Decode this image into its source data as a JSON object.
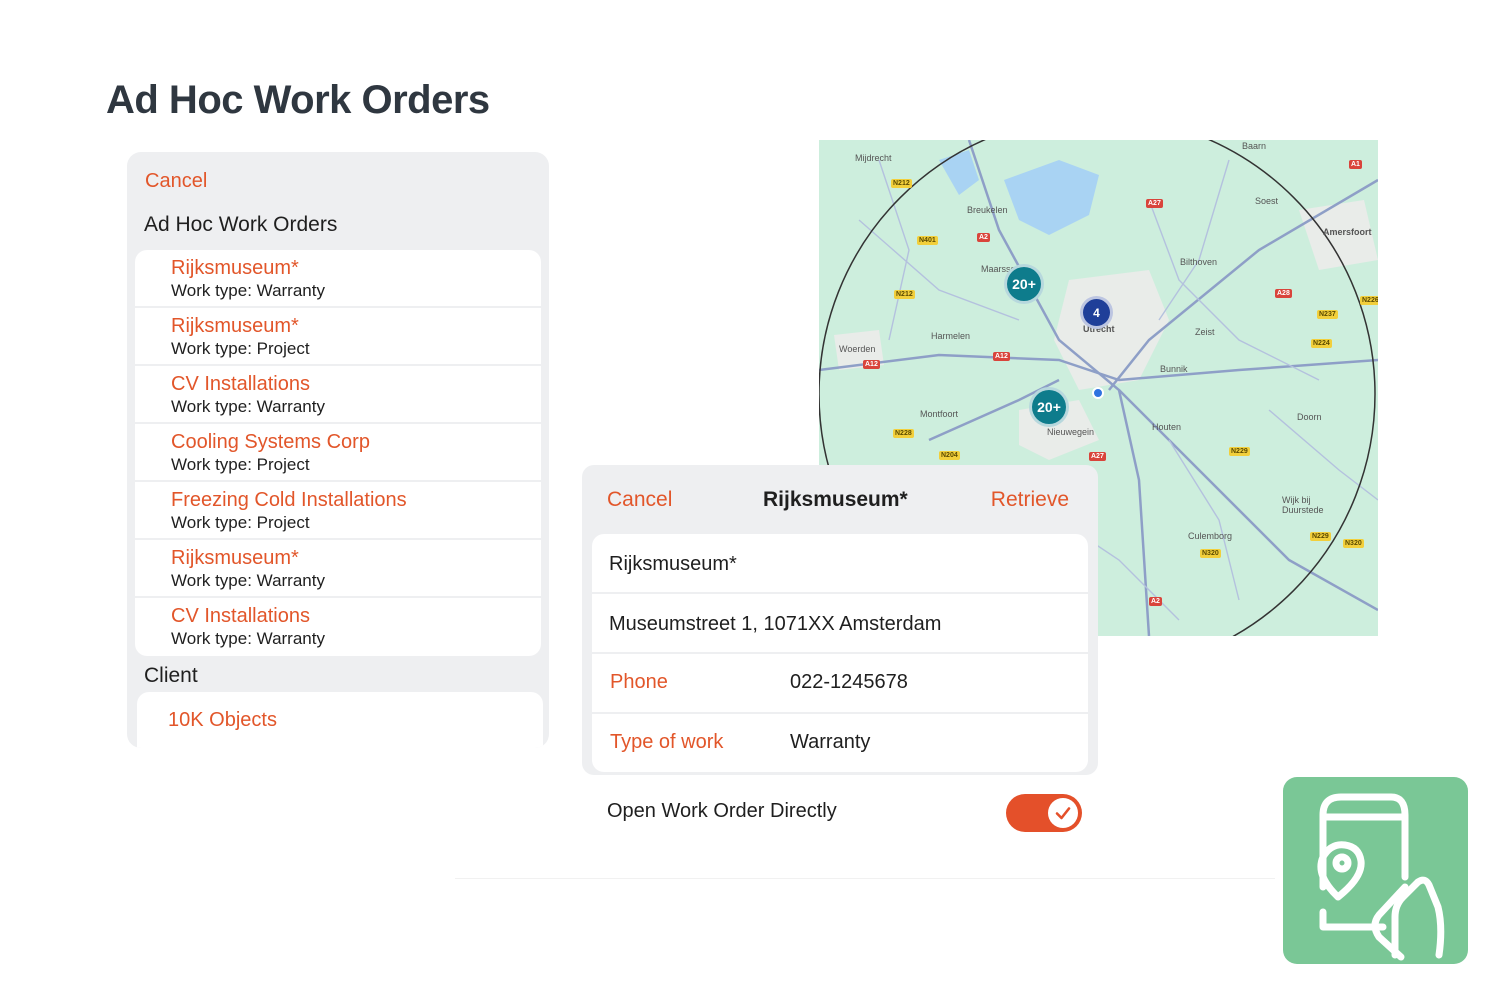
{
  "page": {
    "title": "Ad Hoc Work Orders"
  },
  "list_panel": {
    "cancel_label": "Cancel",
    "heading": "Ad Hoc Work Orders",
    "items": [
      {
        "name": "Rijksmuseum*",
        "type": "Work type: Warranty"
      },
      {
        "name": "Rijksmuseum*",
        "type": "Work type: Project"
      },
      {
        "name": "CV Installations",
        "type": "Work type: Warranty"
      },
      {
        "name": "Cooling Systems Corp",
        "type": "Work type: Project"
      },
      {
        "name": "Freezing Cold Installations",
        "type": "Work type: Project"
      },
      {
        "name": "Rijksmuseum*",
        "type": "Work type: Warranty"
      },
      {
        "name": "CV Installations",
        "type": "Work type: Warranty"
      }
    ],
    "client_heading": "Client",
    "client_value": "10K Objects"
  },
  "map": {
    "places": [
      "Mijdrecht",
      "Breukelen",
      "Maarssen",
      "Utrecht",
      "Woerden",
      "Harmelen",
      "Montfoort",
      "Nieuwegein",
      "Houten",
      "Bunnik",
      "Zeist",
      "Bilthoven",
      "Soest",
      "Baarn",
      "Amersfoort",
      "Doorn",
      "Wijk bij Duurstede",
      "Culemborg"
    ],
    "roads": [
      "N212",
      "N401",
      "A2",
      "A27",
      "N212",
      "A1",
      "N226",
      "A28",
      "N237",
      "N224",
      "A12",
      "A12",
      "N228",
      "N204",
      "A27",
      "N229",
      "N229",
      "N320",
      "N320",
      "A2"
    ],
    "clusters": [
      {
        "label": "20+",
        "color": "#0e7c8c"
      },
      {
        "label": "4",
        "color": "#1f3f99"
      },
      {
        "label": "20+",
        "color": "#0e7c8c"
      }
    ]
  },
  "detail_panel": {
    "cancel_label": "Cancel",
    "title": "Rijksmuseum*",
    "retrieve_label": "Retrieve",
    "name_value": "Rijksmuseum*",
    "address": "Museumstreet 1, 1071XX Amsterdam",
    "phone_label": "Phone",
    "phone_value": "022-1245678",
    "work_label": "Type of work",
    "work_value": "Warranty"
  },
  "open_directly": {
    "label": "Open Work Order Directly",
    "enabled": true
  },
  "colors": {
    "accent": "#e2562a",
    "panel_bg": "#eeeff1",
    "app_icon": "#7ac796"
  },
  "icons": [
    "checkmark-icon",
    "mobile-map-pin-hand-icon"
  ]
}
